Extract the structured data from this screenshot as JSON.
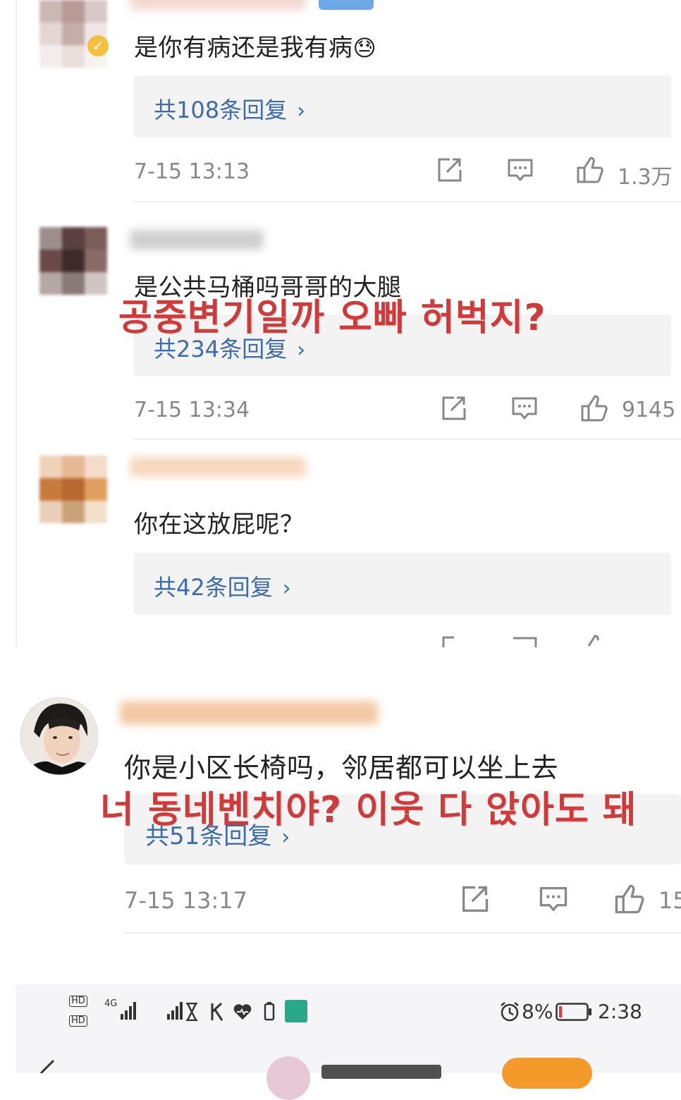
{
  "comments_top": [
    {
      "text": "是你有病还是我有病",
      "emoji": "😓",
      "replies": "共108条回复",
      "time": "7-15 13:13",
      "likes": "1.3万"
    },
    {
      "text": "是公共马桶吗哥哥的大腿",
      "translation": "공중변기일까 오빠 허벅지?",
      "replies": "共234条回复",
      "time": "7-15 13:34",
      "likes": "9145"
    },
    {
      "text": "你在这放屁呢？",
      "replies": "共42条回复"
    }
  ],
  "comment_bottom": {
    "text": "你是小区长椅吗，邻居都可以坐上去",
    "translation": "너 동네벤치야? 이웃 다 앉아도 돼",
    "replies": "共51条回复",
    "time": "7-15 13:17",
    "likes": "15"
  },
  "icons": {
    "share": "share-icon",
    "comment": "comment-icon",
    "like": "thumbs-up-icon",
    "chevron": "›"
  },
  "status_bar": {
    "battery_percent": "8%",
    "time": "2:38",
    "hd_label": "HD",
    "net_label": "4G"
  },
  "colors": {
    "reply_link": "#3b6bb0",
    "translation": "#d23a3a",
    "follow_button": "#f39a2b"
  }
}
